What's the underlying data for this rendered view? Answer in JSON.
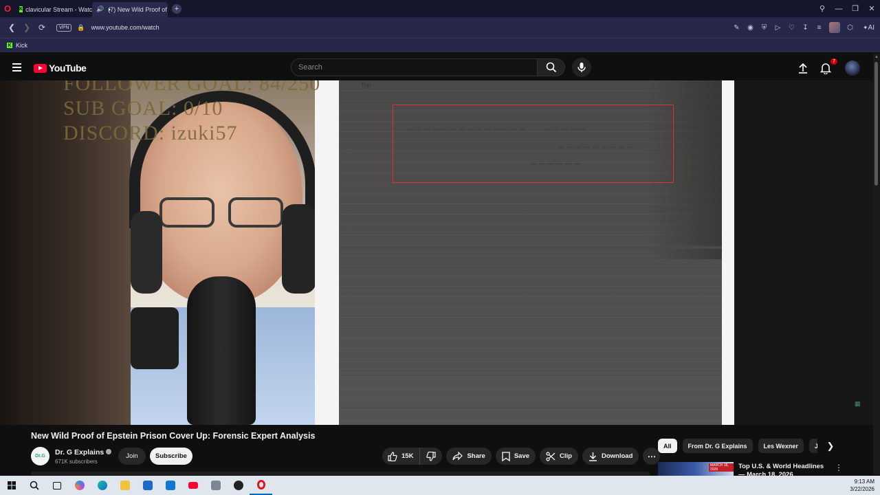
{
  "browser": {
    "tabs": [
      {
        "label": "clavicular Stream - Watch",
        "active": false
      },
      {
        "label": "(7) New Wild Proof of",
        "active": true
      }
    ],
    "vpn_label": "VPN",
    "url": "www.youtube.com/watch",
    "ai_label": "AI",
    "bookmarks": [
      {
        "label": "Kick"
      }
    ]
  },
  "youtube": {
    "logo_text": "YouTube",
    "search_placeholder": "Search",
    "notification_count": "7"
  },
  "video": {
    "overlay": {
      "follower_goal": "FOLLOWER GOAL: 84/250",
      "sub_goal": "SUB GOAL: 0/10",
      "discord": "DISCORD: izuki57"
    },
    "document_label": "Top",
    "title": "New Wild Proof of Epstein Prison Cover Up: Forensic Expert Analysis",
    "channel": {
      "name": "Dr. G Explains",
      "subscribers": "671K subscribers",
      "avatar_text": "Dr.G"
    },
    "join_label": "Join",
    "subscribe_label": "Subscribe",
    "likes": "15K",
    "actions": {
      "share": "Share",
      "save": "Save",
      "clip": "Clip",
      "download": "Download"
    }
  },
  "chips": [
    "All",
    "From Dr. G Explains",
    "Les Wexner",
    "Jeffrey"
  ],
  "recommendation": {
    "title": "Top U.S. & World Headlines — March 18, 2026",
    "thumb_tag": "MARCH 18, 2026"
  },
  "taskbar": {
    "time": "9:13 AM",
    "date": "3/22/2026"
  },
  "colors": {
    "youtube_red": "#ff0033",
    "browser_bg": "#27274a",
    "highlight_box": "#e03030"
  }
}
